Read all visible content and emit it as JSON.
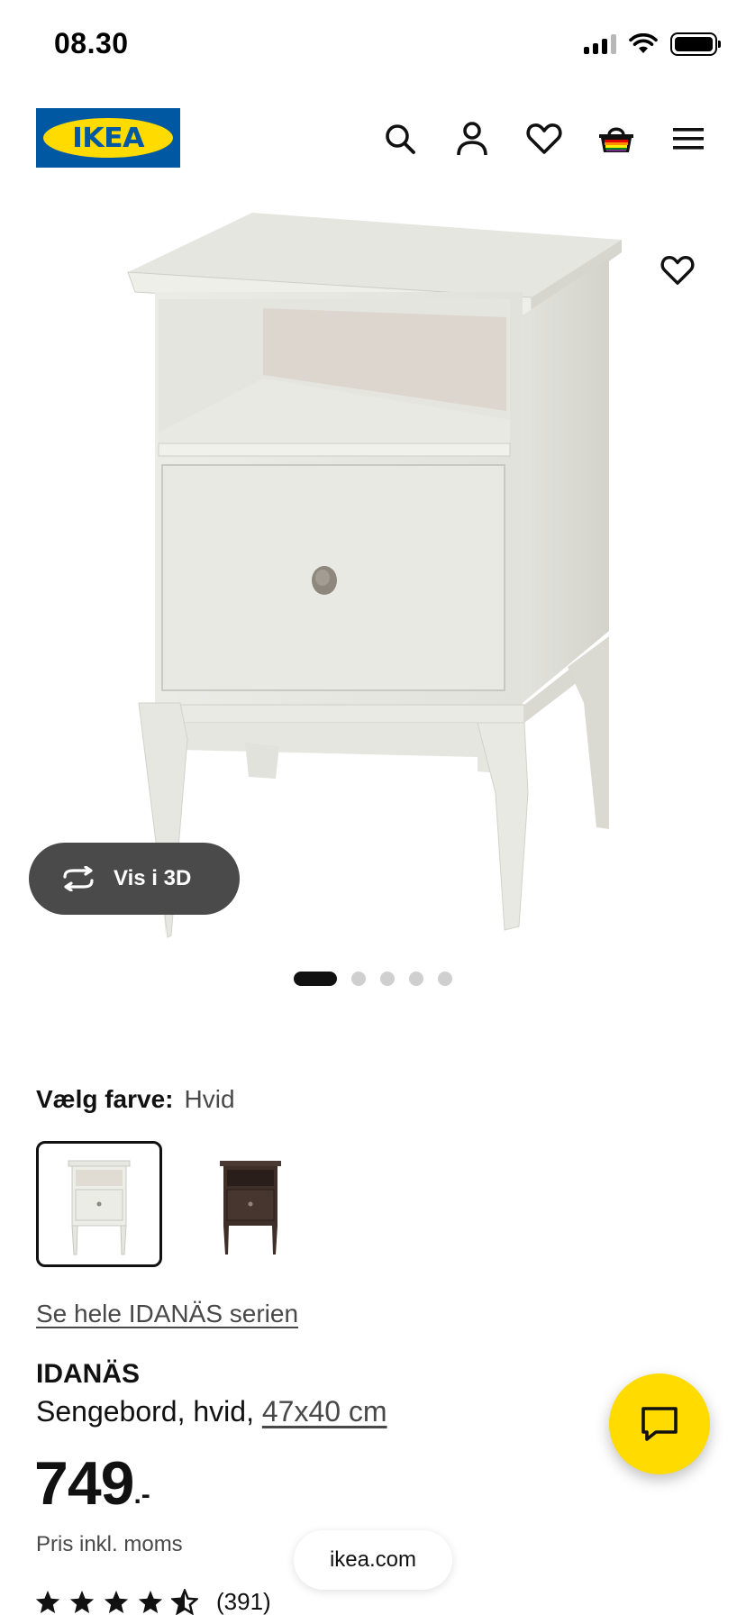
{
  "status_bar": {
    "time": "08.30",
    "icons": [
      "cellular-signal-icon",
      "wifi-icon",
      "battery-icon"
    ]
  },
  "header": {
    "logo_text": "IKEA",
    "brand_colors": {
      "blue": "#0058a3",
      "yellow": "#ffdb00"
    },
    "icons": [
      "search-icon",
      "account-icon",
      "heart-icon",
      "shopping-bag-icon",
      "menu-icon"
    ]
  },
  "product_media": {
    "favorite_icon": "heart-icon",
    "view_3d_label": "Vis i 3D",
    "carousel": {
      "total_images": 5,
      "active_index": 0
    }
  },
  "color_selector": {
    "label": "Vælg farve:",
    "selected_value": "Hvid",
    "options": [
      {
        "name": "white-nightstand",
        "selected": true
      },
      {
        "name": "brown-nightstand",
        "selected": false
      }
    ]
  },
  "series_link": "Se hele IDANÄS serien",
  "product": {
    "name": "IDANÄS",
    "description": "Sengebord, hvid, ",
    "dimensions": "47x40 cm",
    "price": "749",
    "price_suffix": ".-",
    "price_note": "Pris inkl. moms",
    "rating": {
      "stars": 4.5,
      "max": 5,
      "count": "(391)"
    }
  },
  "chat_button_icon": "chat-icon",
  "browser": {
    "domain": "ikea.com"
  }
}
